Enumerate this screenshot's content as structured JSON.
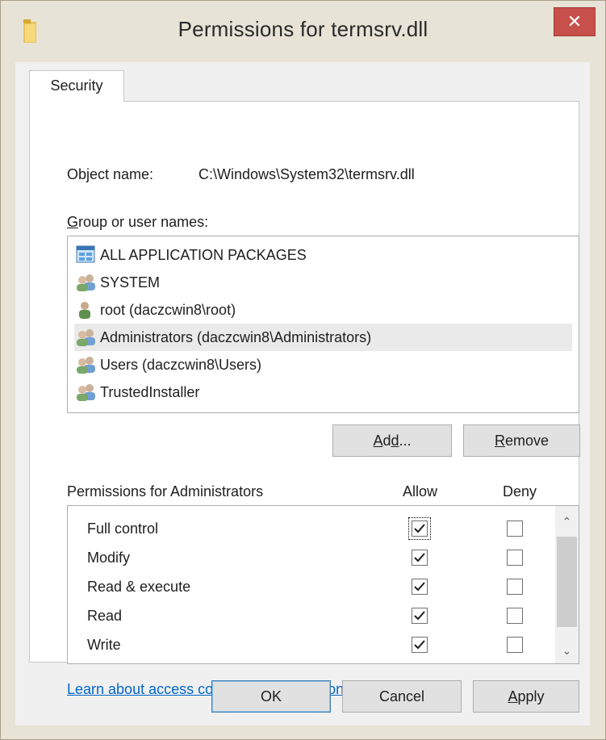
{
  "window": {
    "title": "Permissions for termsrv.dll",
    "close_glyph": "✕",
    "icon": "folder-icon"
  },
  "tabs": [
    {
      "label": "Security",
      "selected": true
    }
  ],
  "object": {
    "label": "Object name:",
    "value": "C:\\Windows\\System32\\termsrv.dll"
  },
  "groups": {
    "label": "Group or user names:",
    "items": [
      {
        "label": "ALL APPLICATION PACKAGES",
        "icon": "app-packages-icon",
        "selected": false
      },
      {
        "label": "SYSTEM",
        "icon": "user-group-icon",
        "selected": false
      },
      {
        "label": "root (daczcwin8\\root)",
        "icon": "user-icon",
        "selected": false
      },
      {
        "label": "Administrators (daczcwin8\\Administrators)",
        "icon": "user-group-icon",
        "selected": true
      },
      {
        "label": "Users (daczcwin8\\Users)",
        "icon": "user-group-icon",
        "selected": false
      },
      {
        "label": "TrustedInstaller",
        "icon": "user-group-icon",
        "selected": false
      }
    ]
  },
  "buttons": {
    "add": "Add...",
    "remove": "Remove",
    "ok": "OK",
    "cancel": "Cancel",
    "apply": "Apply"
  },
  "permissions": {
    "label": "Permissions for Administrators",
    "allow_header": "Allow",
    "deny_header": "Deny",
    "rows": [
      {
        "name": "Full control",
        "allow": true,
        "deny": false
      },
      {
        "name": "Modify",
        "allow": true,
        "deny": false
      },
      {
        "name": "Read & execute",
        "allow": true,
        "deny": false
      },
      {
        "name": "Read",
        "allow": true,
        "deny": false
      },
      {
        "name": "Write",
        "allow": true,
        "deny": false
      }
    ]
  },
  "link": {
    "label": "Learn about access control and permissions"
  },
  "colors": {
    "close_button": "#c7504b",
    "link": "#0066cc",
    "selected_row": "#eaeaea"
  }
}
